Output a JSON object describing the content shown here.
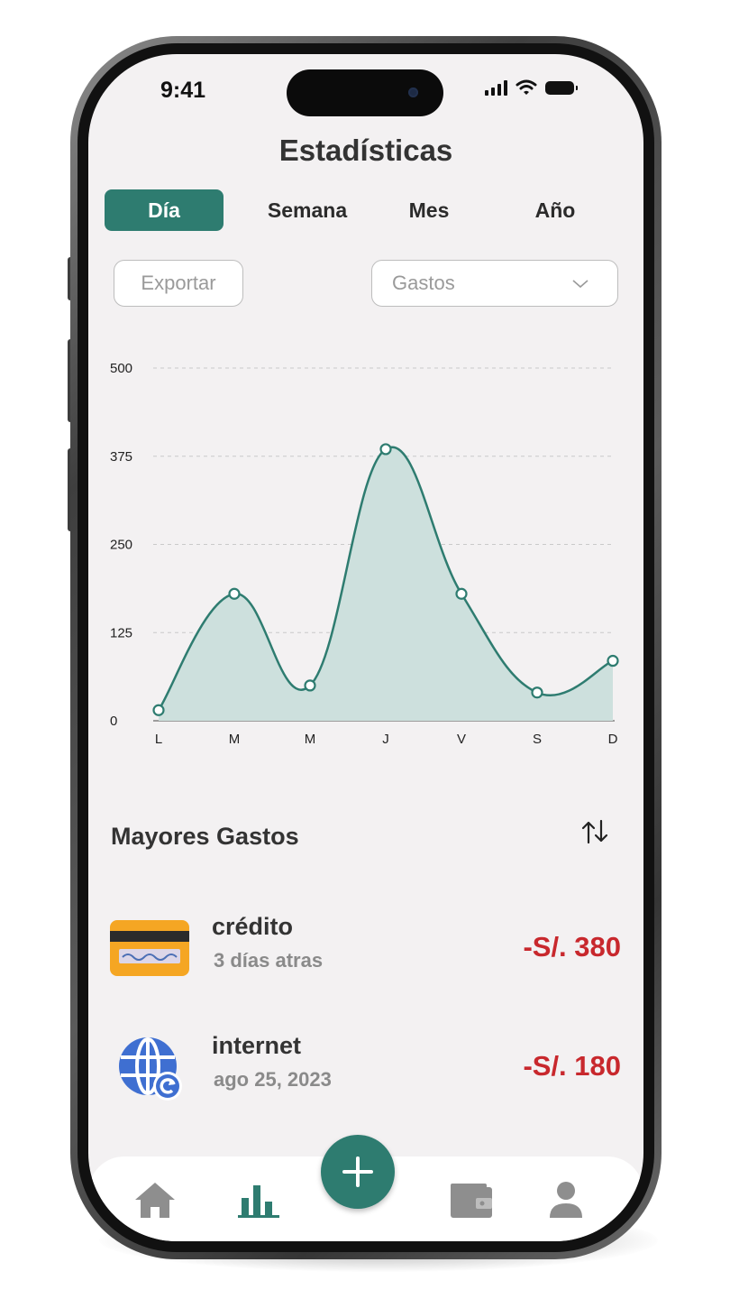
{
  "status_bar": {
    "time": "9:41"
  },
  "header": {
    "title": "Estadísticas"
  },
  "tabs": [
    {
      "label": "Día",
      "active": true
    },
    {
      "label": "Semana",
      "active": false
    },
    {
      "label": "Mes",
      "active": false
    },
    {
      "label": "Año",
      "active": false
    }
  ],
  "toolbar": {
    "export_label": "Exportar",
    "filter_value": "Gastos"
  },
  "chart_data": {
    "type": "area",
    "categories": [
      "L",
      "M",
      "M",
      "J",
      "V",
      "S",
      "D"
    ],
    "values": [
      15,
      180,
      50,
      385,
      180,
      40,
      85
    ],
    "yticks": [
      "0",
      "125",
      "250",
      "375",
      "500"
    ],
    "ylim": [
      0,
      500
    ],
    "grid": true,
    "colors": {
      "line": "#2e7c70",
      "fill": "#cde0dd"
    }
  },
  "top_expenses": {
    "title": "Mayores Gastos",
    "items": [
      {
        "name": "crédito",
        "date": "3 días atras",
        "amount": "-S/. 380",
        "icon": "credit-card-icon"
      },
      {
        "name": "internet",
        "date": "ago 25, 2023",
        "amount": "-S/. 180",
        "icon": "globe-icon"
      }
    ]
  },
  "nav": {
    "items": [
      {
        "icon": "home-icon",
        "active": false
      },
      {
        "icon": "stats-icon",
        "active": true
      },
      {
        "icon": "wallet-icon",
        "active": false
      },
      {
        "icon": "profile-icon",
        "active": false
      }
    ],
    "fab_icon": "plus-icon"
  },
  "colors": {
    "accent": "#2e7c70",
    "negative": "#c8282d",
    "screen_bg": "#f3f1f2"
  }
}
